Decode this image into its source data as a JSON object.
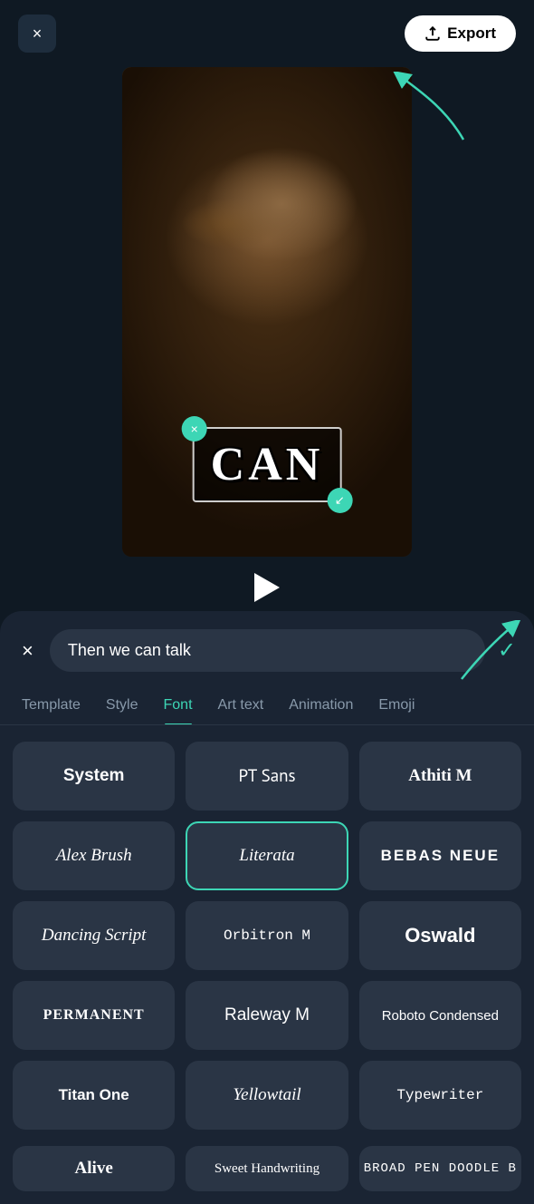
{
  "header": {
    "close_label": "×",
    "export_label": "Export"
  },
  "video": {
    "text": "CAN",
    "overlay_close": "×",
    "overlay_resize": "↙"
  },
  "controls": {
    "play_label": "play"
  },
  "search": {
    "close_label": "×",
    "value": "Then we can talk",
    "check_label": "✓"
  },
  "tabs": [
    {
      "id": "template",
      "label": "Template",
      "active": false
    },
    {
      "id": "style",
      "label": "Style",
      "active": false
    },
    {
      "id": "font",
      "label": "Font",
      "active": true
    },
    {
      "id": "arttext",
      "label": "Art text",
      "active": false
    },
    {
      "id": "animation",
      "label": "Animation",
      "active": false
    },
    {
      "id": "emoji",
      "label": "Emoji",
      "active": false
    }
  ],
  "fonts": [
    {
      "id": "system",
      "label": "System",
      "style": "font-system"
    },
    {
      "id": "ptsans",
      "label": "PT Sans",
      "style": "font-ptsans"
    },
    {
      "id": "athiti",
      "label": "Athiti M",
      "style": "font-athiti"
    },
    {
      "id": "alexbrush",
      "label": "Alex Brush",
      "style": "font-alexbrush"
    },
    {
      "id": "literata",
      "label": "Literata",
      "style": "font-literata",
      "selected": true
    },
    {
      "id": "bebas",
      "label": "BEBAS NEUE",
      "style": "font-bebas"
    },
    {
      "id": "dancing",
      "label": "Dancing Script",
      "style": "font-dancing"
    },
    {
      "id": "orbitron",
      "label": "Orbitron M",
      "style": "font-orbitron"
    },
    {
      "id": "oswald",
      "label": "Oswald",
      "style": "font-oswald"
    },
    {
      "id": "permanent",
      "label": "PERMANENT",
      "style": "font-permanent"
    },
    {
      "id": "raleway",
      "label": "Raleway M",
      "style": "font-raleway"
    },
    {
      "id": "roboto",
      "label": "Roboto Condensed",
      "style": "font-roboto"
    },
    {
      "id": "titanone",
      "label": "Titan One",
      "style": "font-titanone"
    },
    {
      "id": "yellowtail",
      "label": "Yellowtail",
      "style": "font-yellowtail"
    },
    {
      "id": "typewriter",
      "label": "Typewriter",
      "style": "font-typewriter"
    }
  ],
  "partial_fonts": [
    {
      "id": "alive",
      "label": "Alive",
      "style": "font-alive"
    },
    {
      "id": "sweet",
      "label": "Sweet Handwriting",
      "style": "font-sweet"
    },
    {
      "id": "broad",
      "label": "BROAD PEN DOODLE B",
      "style": "font-broad"
    }
  ]
}
